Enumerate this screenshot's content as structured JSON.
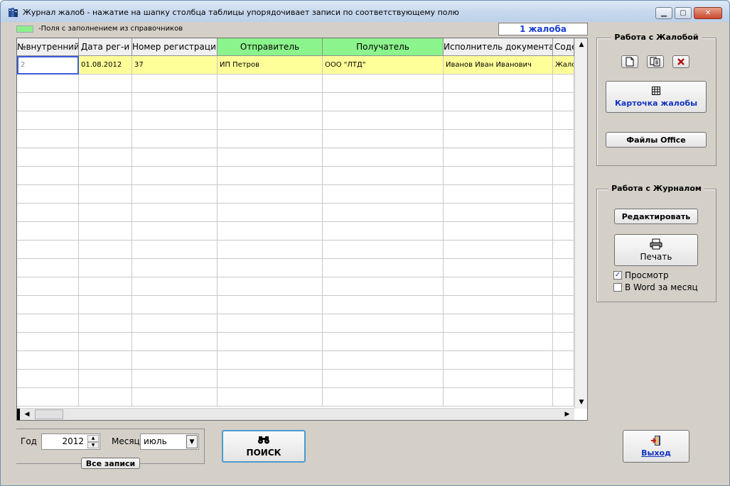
{
  "window": {
    "title": "Журнал жалоб - нажатие на шапку столбца таблицы упорядочивает записи по соответствующему полю"
  },
  "legend": {
    "text": "-Поля с заполнением из справочников"
  },
  "record_count": "1 жалоба",
  "grid": {
    "columns": [
      {
        "label": "№внутренний",
        "green": false
      },
      {
        "label": "Дата рег-и",
        "green": false
      },
      {
        "label": "Номер регистрации",
        "green": false
      },
      {
        "label": "Отправитель",
        "green": true
      },
      {
        "label": "Получатель",
        "green": true
      },
      {
        "label": "Исполнитель документа",
        "green": false
      },
      {
        "label": "Соде",
        "green": false
      }
    ],
    "rows": [
      [
        "2",
        "01.08.2012",
        "37",
        "ИП Петров",
        "ООО \"ЛТД\"",
        "Иванов Иван Иванович",
        "Жало"
      ]
    ]
  },
  "complaint_group": {
    "title": "Работа с Жалобой",
    "card_button": "Карточка жалобы",
    "office_button": "Файлы Office"
  },
  "journal_group": {
    "title": "Работа с Журналом",
    "edit_button": "Редактировать",
    "print_button": "Печать",
    "preview_label": "Просмотр",
    "preview_checked": true,
    "word_label": "В Word за месяц",
    "word_checked": false
  },
  "filter": {
    "year_label": "Год",
    "year_value": "2012",
    "month_label": "Месяц",
    "month_value": "июль",
    "all_button": "Все записи"
  },
  "search_button": "ПОИСК",
  "exit_button": "Выход"
}
